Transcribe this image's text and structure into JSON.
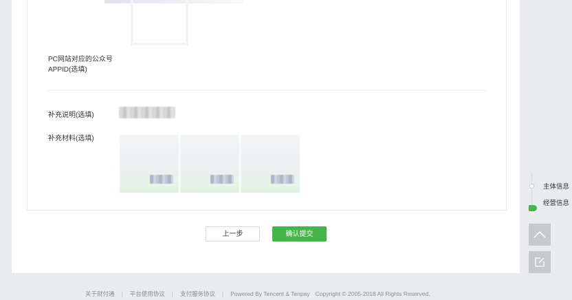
{
  "form": {
    "appid_label": "PC网站对应的公众号APPID(选填)",
    "note_label": "补充说明(选填)",
    "material_label": "补充材料(选填)"
  },
  "actions": {
    "prev_label": "上一步",
    "submit_label": "确认提交"
  },
  "steps": {
    "items": [
      {
        "label": "主体信息",
        "active": false
      },
      {
        "label": "经营信息",
        "active": true
      }
    ]
  },
  "side_tools": [
    {
      "icon": "chevron-up-icon"
    },
    {
      "icon": "edit-icon"
    }
  ],
  "footer": {
    "links": [
      "关于财付通",
      "平台使用协议",
      "支付服务协议"
    ],
    "powered": "Powered By Tencent & Tenpay",
    "copyright": "Copyright © 2005-2018 All Rights Reserved."
  },
  "colors": {
    "accent_green": "#44b549",
    "page_bg": "#eaebee",
    "tool_bg": "#c7c9cd"
  }
}
